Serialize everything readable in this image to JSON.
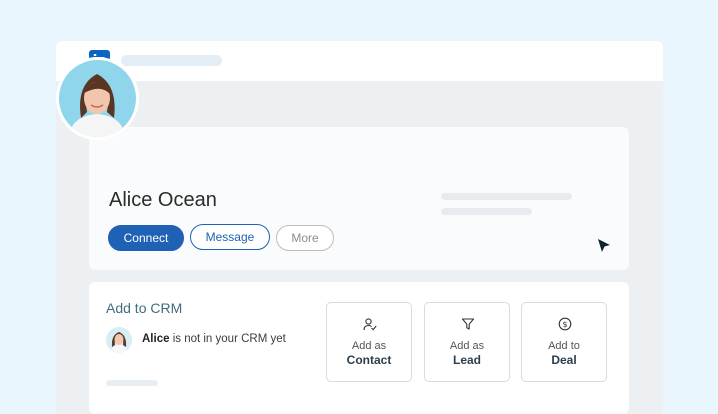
{
  "linkedin": {
    "logo_text": "in"
  },
  "profile": {
    "name": "Alice Ocean",
    "buttons": {
      "connect": "Connect",
      "message": "Message",
      "more": "More"
    }
  },
  "crm": {
    "title": "Add to CRM",
    "status_name": "Alice",
    "status_suffix": " is not in your CRM yet",
    "tiles": [
      {
        "line1": "Add as",
        "line2": "Contact",
        "icon": "user-check-icon"
      },
      {
        "line1": "Add as",
        "line2": "Lead",
        "icon": "funnel-icon"
      },
      {
        "line1": "Add to",
        "line2": "Deal",
        "icon": "dollar-circle-icon"
      }
    ]
  },
  "colors": {
    "linkedin_blue": "#0a66c2",
    "primary_button": "#1f61b4",
    "crm_title": "#3f6e7a"
  }
}
